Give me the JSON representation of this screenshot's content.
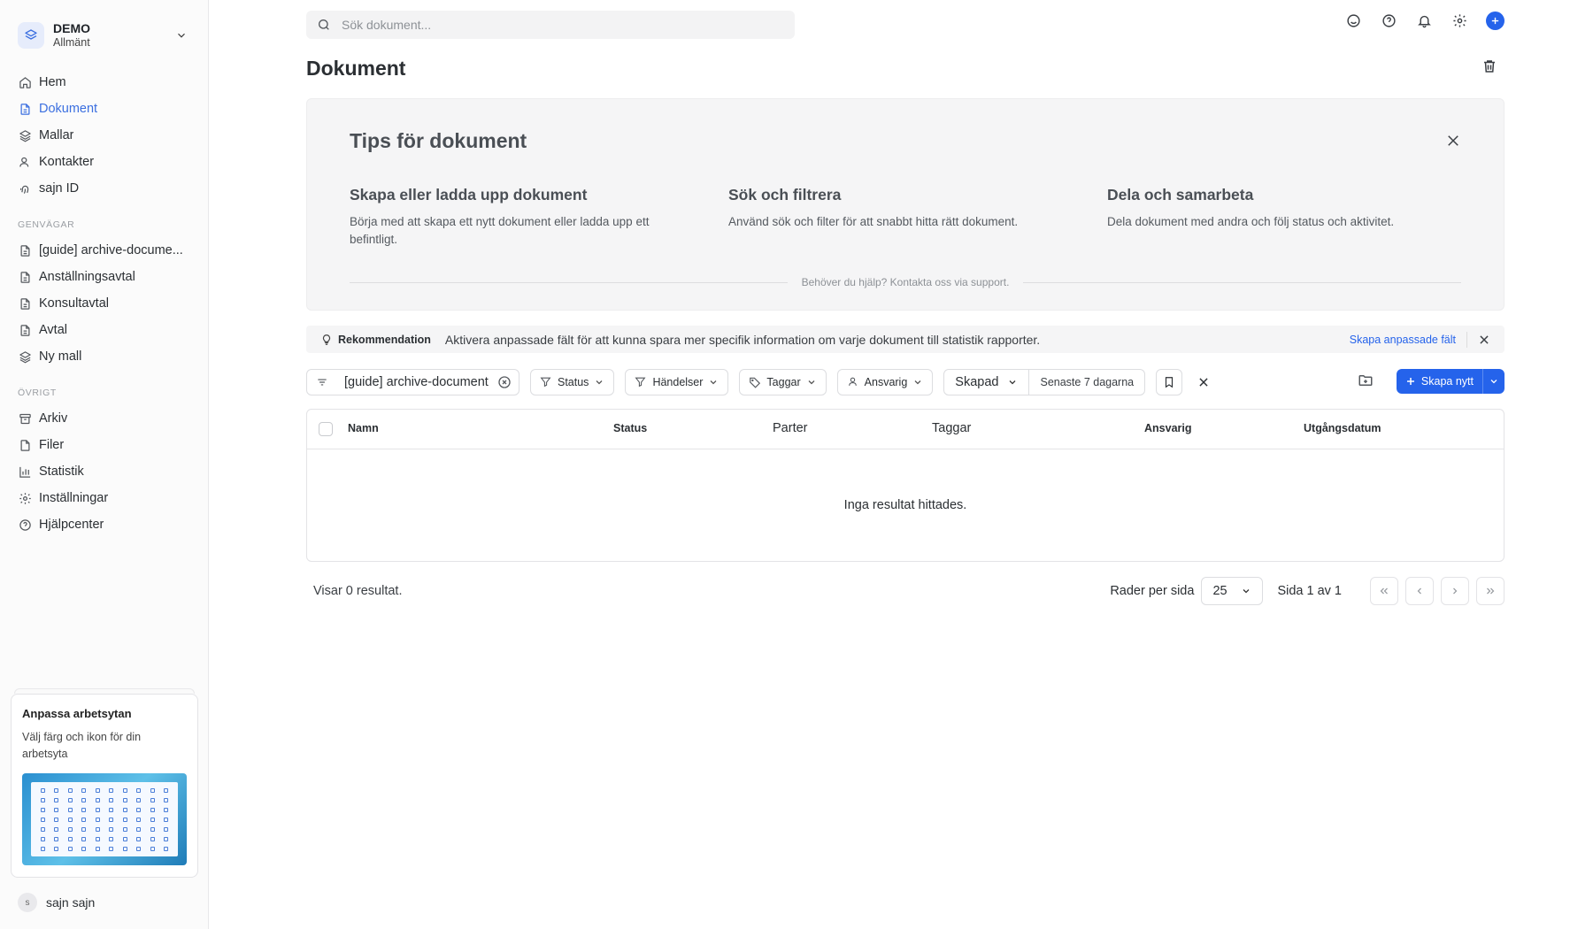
{
  "workspace": {
    "name": "DEMO",
    "subtitle": "Allmänt"
  },
  "nav": {
    "main": [
      {
        "label": "Hem",
        "icon": "home-icon"
      },
      {
        "label": "Dokument",
        "icon": "document-icon",
        "active": true
      },
      {
        "label": "Mallar",
        "icon": "layers-icon"
      },
      {
        "label": "Kontakter",
        "icon": "user-icon"
      },
      {
        "label": "sajn ID",
        "icon": "fingerprint-icon"
      }
    ],
    "shortcuts_label": "GENVÄGAR",
    "shortcuts": [
      {
        "label": "[guide] archive-docume...",
        "icon": "document-icon"
      },
      {
        "label": "Anställningsavtal",
        "icon": "document-icon"
      },
      {
        "label": "Konsultavtal",
        "icon": "document-icon"
      },
      {
        "label": "Avtal",
        "icon": "document-icon"
      },
      {
        "label": "Ny mall",
        "icon": "layers-icon"
      }
    ],
    "other_label": "ÖVRIGT",
    "other": [
      {
        "label": "Arkiv",
        "icon": "archive-icon"
      },
      {
        "label": "Filer",
        "icon": "file-icon"
      },
      {
        "label": "Statistik",
        "icon": "bar-chart-icon"
      },
      {
        "label": "Inställningar",
        "icon": "gear-icon"
      },
      {
        "label": "Hjälpcenter",
        "icon": "help-icon"
      }
    ]
  },
  "promo": {
    "title": "Anpassa arbetsytan",
    "text": "Välj färg och ikon för din arbetsyta"
  },
  "user": {
    "initial": "s",
    "name": "sajn sajn"
  },
  "search": {
    "placeholder": "Sök dokument..."
  },
  "page": {
    "title": "Dokument"
  },
  "tips": {
    "title": "Tips för dokument",
    "columns": [
      {
        "title": "Skapa eller ladda upp dokument",
        "text": "Börja med att skapa ett nytt dokument eller ladda upp ett befintligt."
      },
      {
        "title": "Sök och filtrera",
        "text": "Använd sök och filter för att snabbt hitta rätt dokument."
      },
      {
        "title": "Dela och samarbeta",
        "text": "Dela dokument med andra och följ status och aktivitet."
      }
    ],
    "help": "Behöver du hjälp? Kontakta oss via support."
  },
  "recommendation": {
    "tag": "Rekommendation",
    "message": "Aktivera anpassade fält för att kunna spara mer specifik information om varje dokument till statistik rapporter.",
    "link": "Skapa anpassade fält"
  },
  "filters": {
    "search_value": "[guide] archive-document",
    "status": "Status",
    "events": "Händelser",
    "tags": "Taggar",
    "responsible": "Ansvarig",
    "created": "Skapad",
    "created_range": "Senaste 7 dagarna",
    "create_new": "Skapa nytt"
  },
  "table": {
    "columns": [
      "Namn",
      "Status",
      "Parter",
      "Taggar",
      "Ansvarig",
      "Utgångsdatum"
    ],
    "empty": "Inga resultat hittades."
  },
  "footer": {
    "count": "Visar 0 resultat.",
    "rows_label": "Rader per sida",
    "rows_value": "25",
    "page_info": "Sida 1 av 1"
  },
  "colors": {
    "accent": "#2563eb",
    "active_nav": "#3b6fe0"
  }
}
